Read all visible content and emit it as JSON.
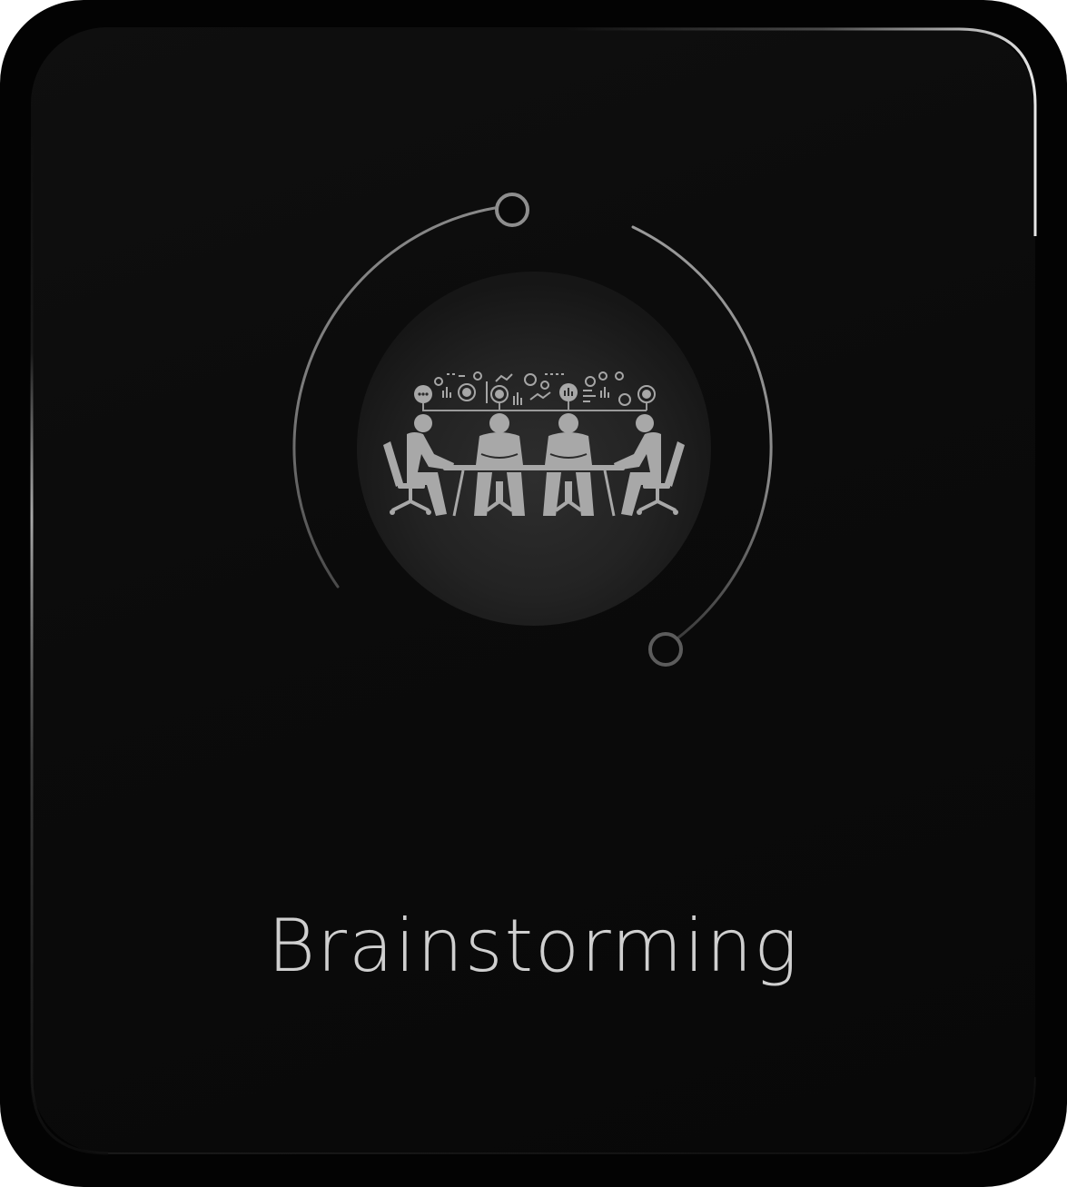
{
  "card": {
    "title": "Brainstorming",
    "icon": "meeting-team-brainstorm-icon",
    "colors": {
      "background": "#030303",
      "panel": "#0c0c0c",
      "text": "#cfcfcf",
      "accent_ring": "#9a9a9a"
    }
  }
}
